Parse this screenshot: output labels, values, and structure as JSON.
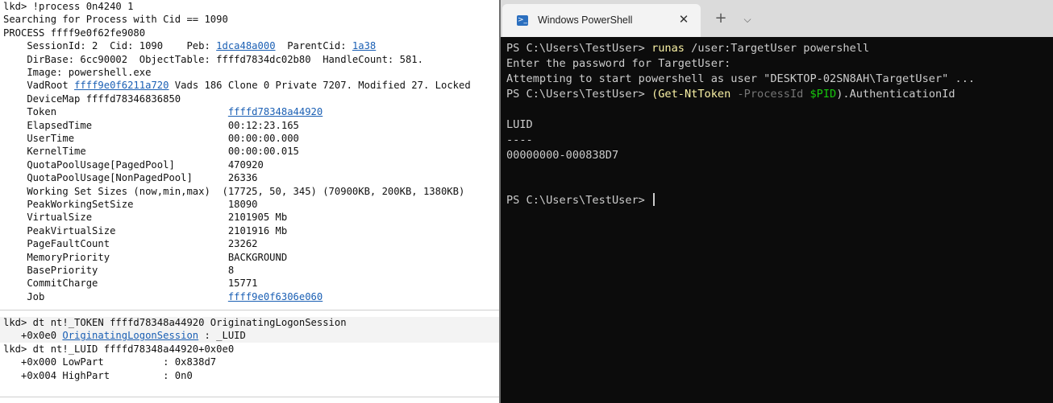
{
  "debugger": {
    "lines": [
      {
        "text": "lkd> !process 0n4240 1"
      },
      {
        "text": "Searching for Process with Cid == 1090"
      },
      {
        "text": "PROCESS ffff9e0f62fe9080"
      },
      {
        "pre": "    SessionId: 2  Cid: 1090    Peb: ",
        "link": "1dca48a000",
        "mid": "  ParentCid: ",
        "link2": "1a38"
      },
      {
        "text": "    DirBase: 6cc90002  ObjectTable: ffffd7834dc02b80  HandleCount: 581."
      },
      {
        "text": "    Image: powershell.exe"
      },
      {
        "pre": "    VadRoot ",
        "link": "ffff9e0f6211a720",
        "post": " Vads 186 Clone 0 Private 7207. Modified 27. Locked"
      },
      {
        "text": "    DeviceMap ffffd78346836850"
      },
      {
        "pre": "    Token                             ",
        "link": "ffffd78348a44920"
      },
      {
        "text": "    ElapsedTime                       00:12:23.165"
      },
      {
        "text": "    UserTime                          00:00:00.000"
      },
      {
        "text": "    KernelTime                        00:00:00.015"
      },
      {
        "text": "    QuotaPoolUsage[PagedPool]         470920"
      },
      {
        "text": "    QuotaPoolUsage[NonPagedPool]      26336"
      },
      {
        "text": "    Working Set Sizes (now,min,max)  (17725, 50, 345) (70900KB, 200KB, 1380KB)"
      },
      {
        "text": "    PeakWorkingSetSize                18090"
      },
      {
        "text": "    VirtualSize                       2101905 Mb"
      },
      {
        "text": "    PeakVirtualSize                   2101916 Mb"
      },
      {
        "text": "    PageFaultCount                    23262"
      },
      {
        "text": "    MemoryPriority                    BACKGROUND"
      },
      {
        "text": "    BasePriority                      8"
      },
      {
        "text": "    CommitCharge                      15771"
      },
      {
        "pre": "    Job                               ",
        "link": "ffff9e0f6306e060"
      }
    ],
    "lines2": [
      {
        "text": "lkd> dt nt!_TOKEN ffffd78348a44920 OriginatingLogonSession"
      },
      {
        "pre": "   +0x0e0 ",
        "link": "OriginatingLogonSession",
        "post": " : _LUID"
      },
      {
        "text": "lkd> dt nt!_LUID ffffd78348a44920+0x0e0"
      },
      {
        "text": "   +0x000 LowPart          : 0x838d7"
      },
      {
        "text": "   +0x004 HighPart         : 0n0"
      }
    ]
  },
  "terminal": {
    "tab_title": "Windows PowerShell",
    "close_glyph": "✕",
    "new_tab_glyph": "+",
    "dropdown_glyph": "⌵",
    "icon_glyph": ">_",
    "line1": {
      "prompt": "PS C:\\Users\\TestUser> ",
      "cmd": "runas",
      "args": " /user:TargetUser powershell"
    },
    "line2": "Enter the password for TargetUser:",
    "line3": "Attempting to start powershell as user \"DESKTOP-02SN8AH\\TargetUser\" ...",
    "line4": {
      "prompt": "PS C:\\Users\\TestUser> ",
      "open": "(",
      "cmd": "Get-NtToken",
      "sp": " ",
      "param": "-ProcessId",
      "sp2": " ",
      "var": "$PID",
      "close": ").AuthenticationId"
    },
    "header": "LUID",
    "dashes": "----",
    "value": "00000000-000838D7",
    "final_prompt": "PS C:\\Users\\TestUser> "
  },
  "colors": {
    "terminal_bg": "#0c0c0c",
    "command": "#f9f1a5",
    "parameter": "#767676",
    "variable": "#16c60c",
    "link": "#1a5fb4"
  }
}
